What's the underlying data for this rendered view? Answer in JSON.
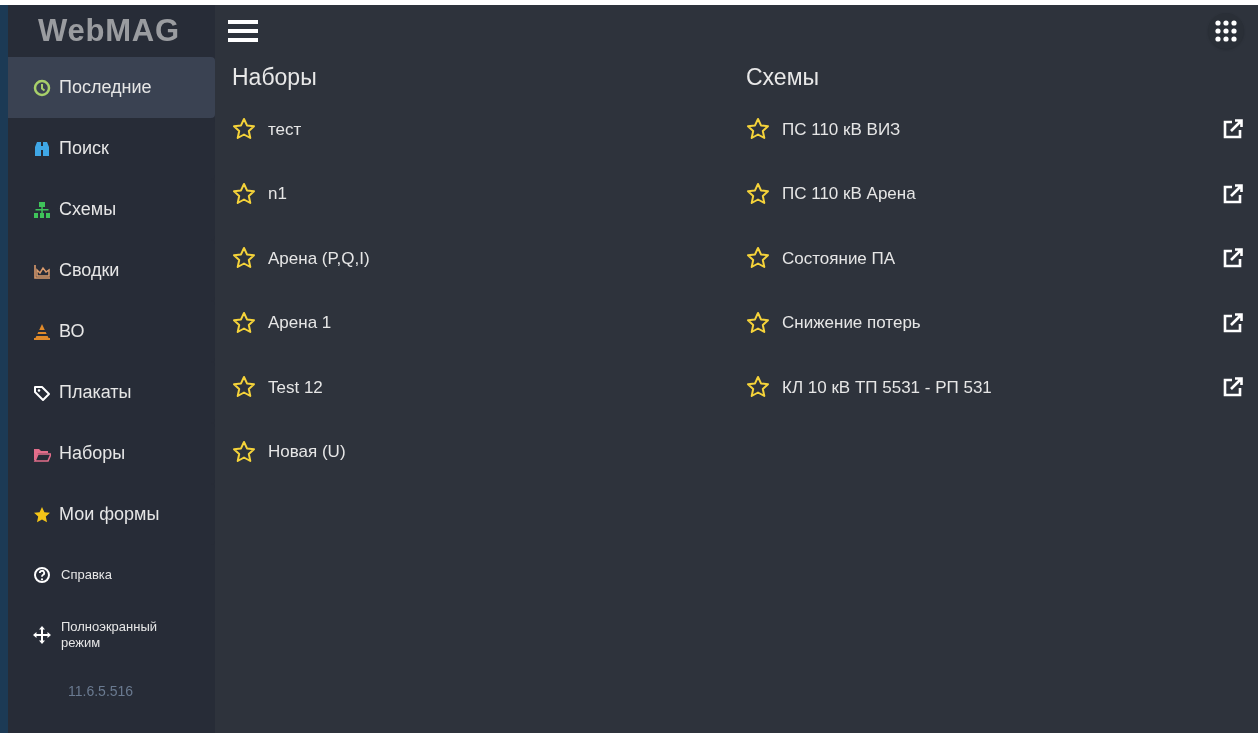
{
  "sidebar": {
    "logo": "WebMAG",
    "items": [
      {
        "label": "Последние",
        "selected": true
      },
      {
        "label": "Поиск",
        "selected": false
      },
      {
        "label": "Схемы",
        "selected": false
      },
      {
        "label": "Сводки",
        "selected": false
      },
      {
        "label": "ВО",
        "selected": false
      },
      {
        "label": "Плакаты",
        "selected": false
      },
      {
        "label": "Наборы",
        "selected": false
      },
      {
        "label": "Мои формы",
        "selected": false
      }
    ],
    "utility_items": [
      {
        "label": "Справка"
      },
      {
        "label": "Полноэкранный режим"
      }
    ],
    "version": "11.6.5.516"
  },
  "sets": {
    "title": "Наборы",
    "items": [
      {
        "label": "тест",
        "favorite": false
      },
      {
        "label": "n1",
        "favorite": false
      },
      {
        "label": "Арена (P,Q,I)",
        "favorite": false
      },
      {
        "label": "Арена 1",
        "favorite": false
      },
      {
        "label": "Test 12",
        "favorite": false
      },
      {
        "label": "Новая (U)",
        "favorite": false
      }
    ]
  },
  "schemes": {
    "title": "Схемы",
    "items": [
      {
        "label": "ПС 110 кВ ВИЗ",
        "favorite": false
      },
      {
        "label": "ПС 110 кВ Арена",
        "favorite": false
      },
      {
        "label": "Состояние ПА",
        "favorite": false
      },
      {
        "label": "Снижение потерь",
        "favorite": false
      },
      {
        "label": "КЛ 10 кВ ТП 5531 - РП 531",
        "favorite": false
      }
    ]
  }
}
